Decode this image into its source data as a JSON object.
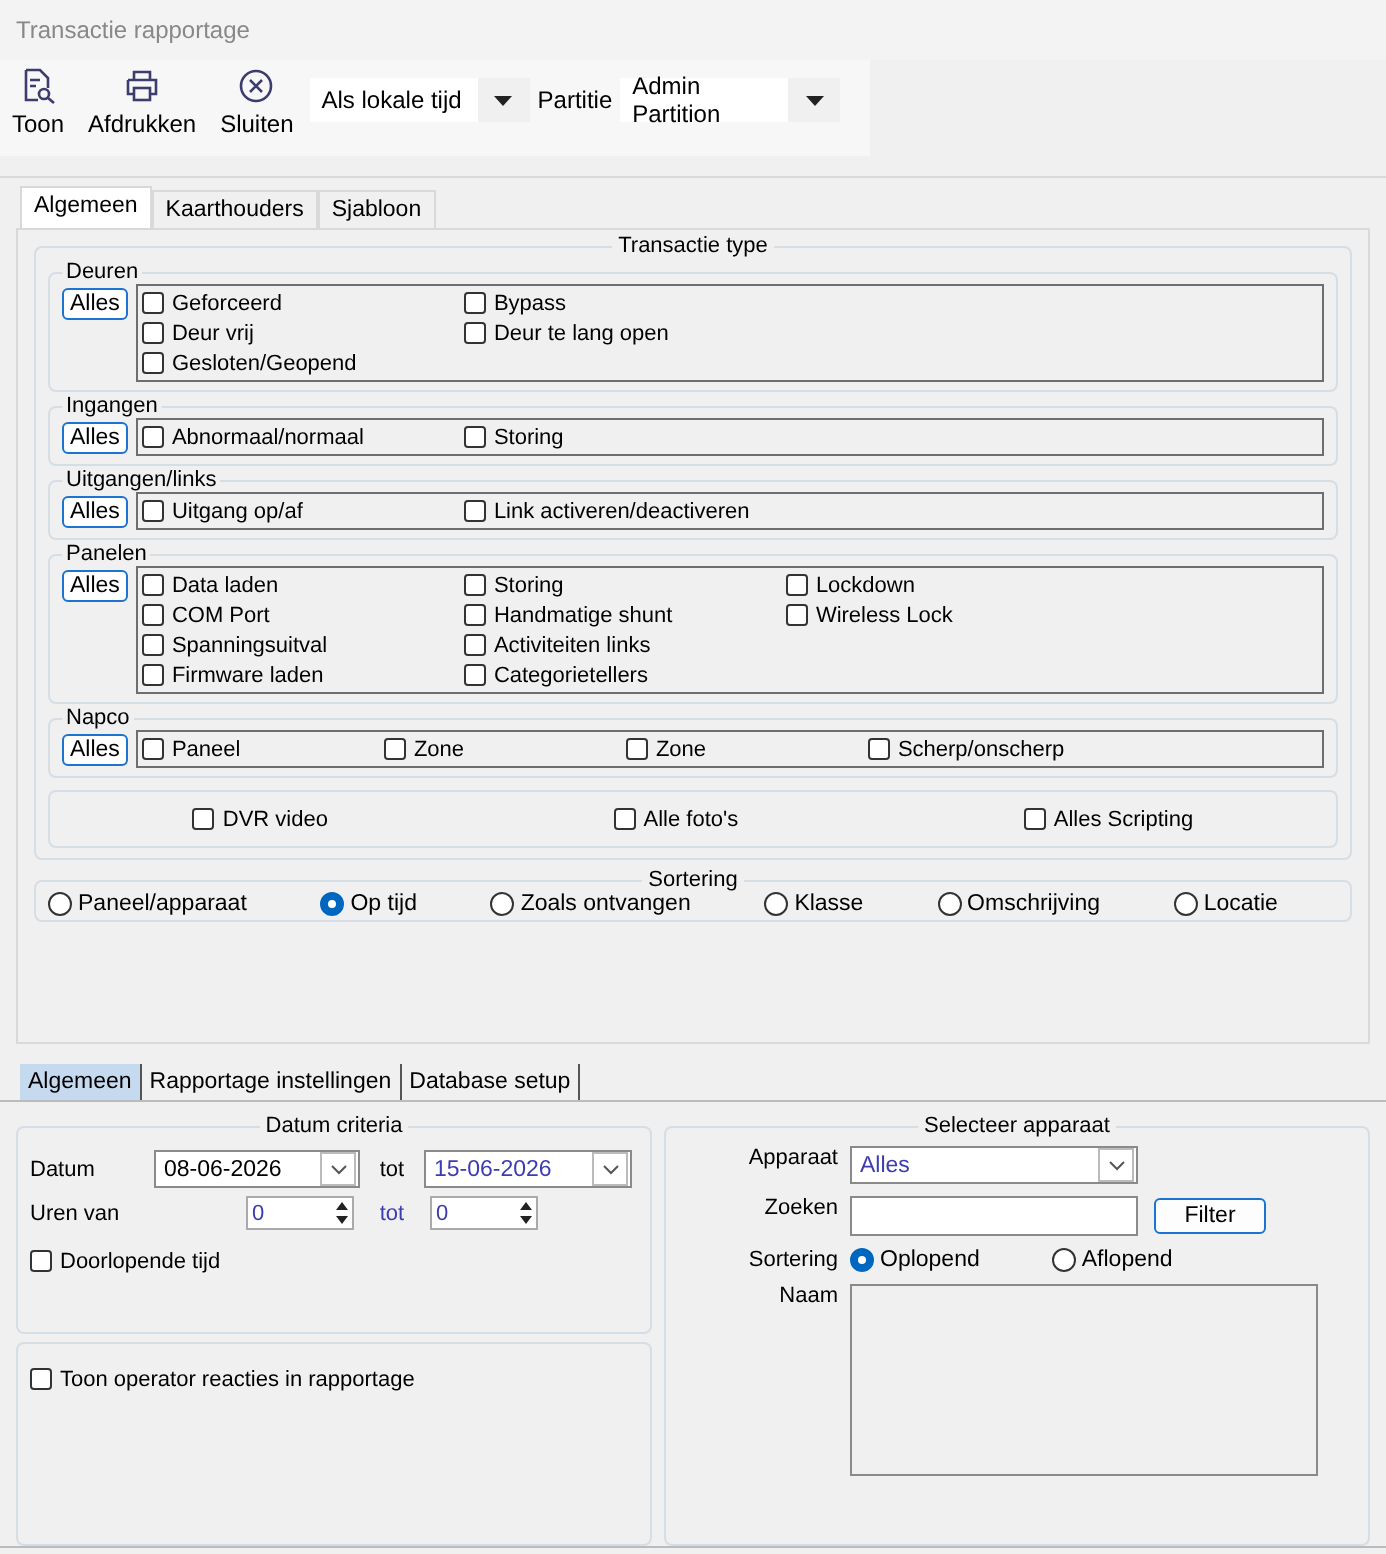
{
  "window": {
    "title": "Transactie rapportage"
  },
  "toolbar": {
    "buttons": [
      {
        "label": "Toon",
        "kind": "preview"
      },
      {
        "label": "Afdrukken",
        "kind": "print"
      },
      {
        "label": "Sluiten",
        "kind": "close"
      }
    ],
    "time_mode": "Als lokale tijd",
    "partition_label": "Partitie",
    "partition": "Admin Partition"
  },
  "top_tabs": [
    {
      "label": "Algemeen",
      "selected": true
    },
    {
      "label": "Kaarthouders",
      "selected": false
    },
    {
      "label": "Sjabloon",
      "selected": false
    }
  ],
  "transaction_type": {
    "title": "Transactie type",
    "groups": [
      {
        "title": "Deuren",
        "all_button": "Alles",
        "columns": [
          [
            {
              "label": "Geforceerd",
              "checked": false
            },
            {
              "label": "Deur vrij",
              "checked": false
            },
            {
              "label": "Gesloten/Geopend",
              "checked": false
            }
          ],
          [
            {
              "label": "Bypass",
              "checked": false
            },
            {
              "label": "Deur te lang open",
              "checked": false
            }
          ]
        ]
      },
      {
        "title": "Ingangen",
        "all_button": "Alles",
        "columns": [
          [
            {
              "label": "Abnormaal/normaal",
              "checked": false
            }
          ],
          [
            {
              "label": "Storing",
              "checked": false
            }
          ]
        ]
      },
      {
        "title": "Uitgangen/links",
        "all_button": "Alles",
        "columns": [
          [
            {
              "label": "Uitgang op/af",
              "checked": false
            }
          ],
          [
            {
              "label": "Link activeren/deactiveren",
              "checked": false
            }
          ]
        ]
      },
      {
        "title": "Panelen",
        "all_button": "Alles",
        "columns": [
          [
            {
              "label": "Data laden",
              "checked": false
            },
            {
              "label": "COM Port",
              "checked": false
            },
            {
              "label": "Spanningsuitval",
              "checked": false
            },
            {
              "label": "Firmware laden",
              "checked": false
            }
          ],
          [
            {
              "label": "Storing",
              "checked": false
            },
            {
              "label": "Handmatige shunt",
              "checked": false
            },
            {
              "label": "Activiteiten links",
              "checked": false
            },
            {
              "label": "Categorietellers",
              "checked": false
            }
          ],
          [
            {
              "label": "Lockdown",
              "checked": false
            },
            {
              "label": "Wireless Lock",
              "checked": false
            }
          ]
        ]
      },
      {
        "title": "Napco",
        "all_button": "Alles",
        "columns": [
          [
            {
              "label": "Paneel",
              "checked": false
            }
          ],
          [
            {
              "label": "Zone",
              "checked": false
            }
          ],
          [
            {
              "label": "Zone",
              "checked": false
            }
          ],
          [
            {
              "label": "Scherp/onscherp",
              "checked": false
            }
          ]
        ]
      }
    ],
    "extras": [
      {
        "label": "DVR video",
        "checked": false
      },
      {
        "label": "Alle foto's",
        "checked": false
      },
      {
        "label": "Alles Scripting",
        "checked": false
      }
    ]
  },
  "sorting": {
    "title": "Sortering",
    "options": [
      {
        "label": "Paneel/apparaat",
        "selected": false
      },
      {
        "label": "Op tijd",
        "selected": true
      },
      {
        "label": "Zoals ontvangen",
        "selected": false
      },
      {
        "label": "Klasse",
        "selected": false
      },
      {
        "label": "Omschrijving",
        "selected": false
      },
      {
        "label": "Locatie",
        "selected": false
      }
    ]
  },
  "bottom_tabs": [
    {
      "label": "Algemeen",
      "selected": true
    },
    {
      "label": "Rapportage instellingen",
      "selected": false
    },
    {
      "label": "Database setup",
      "selected": false
    }
  ],
  "date_criteria": {
    "title": "Datum criteria",
    "date_label": "Datum",
    "date_from": "08-06-2026",
    "date_to_label": "tot",
    "date_to": "15-06-2026",
    "hours_label": "Uren van",
    "hours_from": "0",
    "hours_to_label": "tot",
    "hours_to": "0",
    "continuous": {
      "label": "Doorlopende tijd",
      "checked": false
    }
  },
  "operator_reactions": {
    "label": "Toon operator reacties in rapportage",
    "checked": false
  },
  "device_select": {
    "title": "Selecteer apparaat",
    "device_label": "Apparaat",
    "device": "Alles",
    "search_label": "Zoeken",
    "filter_button": "Filter",
    "sort_label": "Sortering",
    "sort_options": [
      {
        "label": "Oplopend",
        "selected": true
      },
      {
        "label": "Aflopend",
        "selected": false
      }
    ],
    "name_label": "Naam"
  }
}
